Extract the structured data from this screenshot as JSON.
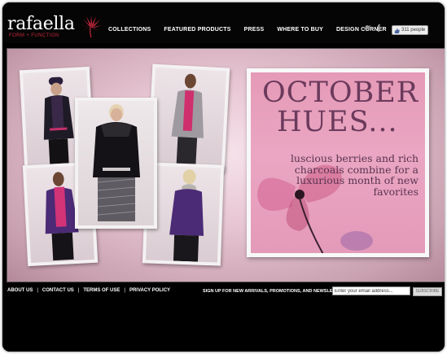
{
  "brand": {
    "name": "rafaella",
    "tagline": "FORM + FUNCTION",
    "accent_color": "#c8283c"
  },
  "nav": {
    "items": [
      {
        "label": "COLLECTIONS"
      },
      {
        "label": "FEATURED PRODUCTS"
      },
      {
        "label": "PRESS"
      },
      {
        "label": "WHERE TO BUY"
      },
      {
        "label": "DESIGN CORNER"
      }
    ]
  },
  "social": {
    "twitter_icon": "twitter-icon",
    "facebook_icon": "facebook-icon",
    "facebook_glyph": "f",
    "like_count": "311 people"
  },
  "promo": {
    "title_line1": "OCTOBER",
    "title_line2": "HUES...",
    "body": "luscious berries and rich charcoals combine for a luxurious month of new favorites",
    "text_color": "#6b3a5c",
    "background_color": "#e8a3bf"
  },
  "footer": {
    "links": [
      {
        "label": "ABOUT US"
      },
      {
        "label": "CONTACT US"
      },
      {
        "label": "TERMS OF USE"
      },
      {
        "label": "PRIVACY POLICY"
      }
    ],
    "separator": "|",
    "signup_text": "SIGN UP FOR NEW ARRIVALS, PROMOTIONS, AND NEWSLETTER",
    "email_value": "Enter your email address...",
    "subscribe_label": "SUBSCRIBE"
  }
}
